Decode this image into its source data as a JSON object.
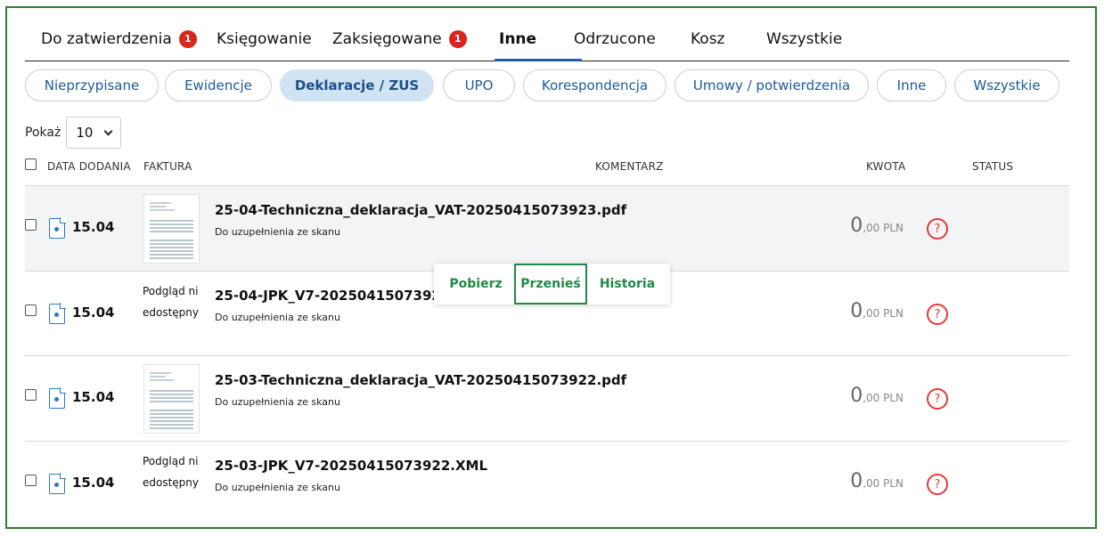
{
  "tabs": [
    {
      "label": "Do zatwierdzenia",
      "badge": "1"
    },
    {
      "label": "Księgowanie"
    },
    {
      "label": "Zaksięgowane",
      "badge": "1"
    },
    {
      "label": "Inne",
      "active": true
    },
    {
      "label": "Odrzucone"
    },
    {
      "label": "Kosz"
    },
    {
      "label": "Wszystkie"
    }
  ],
  "filters": [
    {
      "label": "Nieprzypisane"
    },
    {
      "label": "Ewidencje"
    },
    {
      "label": "Deklaracje / ZUS",
      "active": true
    },
    {
      "label": "UPO"
    },
    {
      "label": "Korespondencja"
    },
    {
      "label": "Umowy / potwierdzenia"
    },
    {
      "label": "Inne"
    },
    {
      "label": "Wszystkie"
    }
  ],
  "show": {
    "label": "Pokaż",
    "value": "10"
  },
  "columns": {
    "date": "DATA DODANIA",
    "invoice": "FAKTURA",
    "comment": "KOMENTARZ",
    "amount": "KWOTA",
    "status": "STATUS"
  },
  "rows": [
    {
      "date": "15.04",
      "preview": "image",
      "preview_text": "",
      "file": "25-04-Techniczna_deklaracja_VAT-20250415073923.pdf",
      "desc": "Do uzupełnienia ze skanu",
      "amount_int": "0",
      "amount_dec": ",00 PLN",
      "status": "?"
    },
    {
      "date": "15.04",
      "preview": "none",
      "preview_text": "Podgląd niedostępny",
      "file": "25-04-JPK_V7-20250415073923.XML",
      "desc": "Do uzupełnienia ze skanu",
      "amount_int": "0",
      "amount_dec": ",00 PLN",
      "status": "?"
    },
    {
      "date": "15.04",
      "preview": "image",
      "preview_text": "",
      "file": "25-03-Techniczna_deklaracja_VAT-20250415073922.pdf",
      "desc": "Do uzupełnienia ze skanu",
      "amount_int": "0",
      "amount_dec": ",00 PLN",
      "status": "?"
    },
    {
      "date": "15.04",
      "preview": "none",
      "preview_text": "Podgląd niedostępny",
      "file": "25-03-JPK_V7-20250415073922.XML",
      "desc": "Do uzupełnienia ze skanu",
      "amount_int": "0",
      "amount_dec": ",00 PLN",
      "status": "?"
    }
  ],
  "popover": {
    "download": "Pobierz",
    "move": "Przenieś",
    "history": "Historia"
  },
  "colors": {
    "frame": "#2e7d32",
    "accent": "#1f5fa8",
    "badge": "#d7261e",
    "action": "#1f8a45",
    "status": "#e53935"
  }
}
